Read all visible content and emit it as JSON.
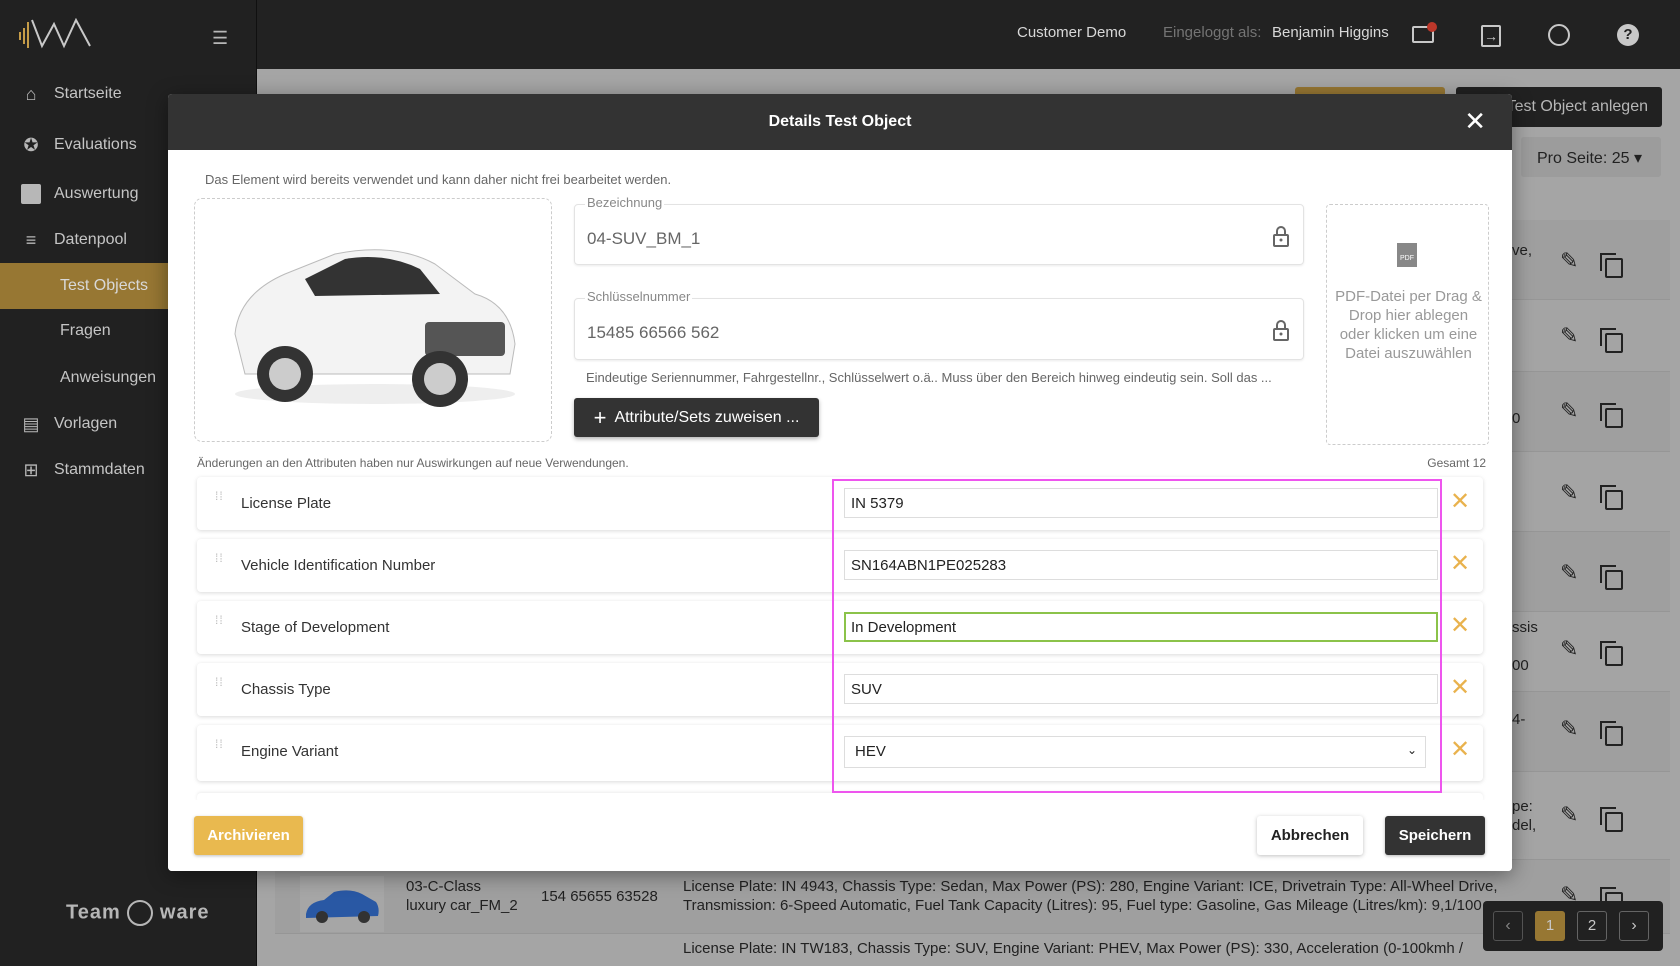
{
  "topbar": {
    "customer": "Customer Demo",
    "logged_in_label": "Eingeloggt als:",
    "user": "Benjamin Higgins"
  },
  "sidebar": {
    "items": [
      {
        "label": "Startseite",
        "icon": "home-icon"
      },
      {
        "label": "Evaluations",
        "icon": "star-icon"
      },
      {
        "label": "Auswertung",
        "icon": "chart-icon"
      },
      {
        "label": "Datenpool",
        "icon": "server-icon"
      },
      {
        "label": "Test Objects",
        "sub": true,
        "active": true
      },
      {
        "label": "Fragen",
        "sub": true
      },
      {
        "label": "Anweisungen",
        "sub": true
      },
      {
        "label": "Vorlagen",
        "icon": "layout-icon"
      },
      {
        "label": "Stammdaten",
        "icon": "hierarchy-icon"
      }
    ],
    "footer_logo": "Teamware SOLUTIONS"
  },
  "background": {
    "create_button": "Test Object anlegen",
    "per_page": "Pro Seite: 25",
    "row_fragments": [
      "ve,",
      "",
      "0",
      "",
      "",
      "ssis",
      "4-",
      "pe:",
      "del,",
      "00",
      ":"
    ],
    "list_row": {
      "name_line1": "03-C-Class",
      "name_line2": "luxury car_FM_2",
      "key": "154 65655 63528",
      "desc_line1": "License Plate: IN 4943, Chassis Type: Sedan, Max Power (PS): 280, Engine Variant: ICE, Drivetrain Type: All-Wheel Drive,",
      "desc_line2": "Transmission: 6-Speed Automatic, Fuel Tank Capacity (Litres): 95, Fuel type: Gasoline, Gas Mileage (Litres/km): 9,1/100"
    },
    "list_row2": {
      "desc_line1": "License Plate: IN TW183, Chassis Type: SUV, Engine Variant: PHEV, Max Power (PS): 330, Acceleration (0-100kmh /"
    },
    "pagination": {
      "pages": [
        "1",
        "2"
      ],
      "current": "1"
    }
  },
  "modal": {
    "title": "Details Test Object",
    "notice": "Das Element wird bereits verwendet und kann daher nicht frei bearbeitet werden.",
    "bezeichnung": {
      "label": "Bezeichnung",
      "value": "04-SUV_BM_1"
    },
    "schluessel": {
      "label": "Schlüsselnummer",
      "value": "15485 66566 562"
    },
    "hint": "Eindeutige Seriennummer, Fahrgestellnr., Schlüsselwert o.ä.. Muss über den Bereich hinweg eindeutig sein. Soll das ...",
    "assign_button": "Attribute/Sets zuweisen ...",
    "pdf_drop": "PDF-Datei per Drag & Drop hier ablegen oder klicken um eine Datei auszuwählen",
    "changes_note": "Änderungen an den Attributen haben nur Auswirkungen auf neue Verwendungen.",
    "total": "Gesamt 12",
    "attributes": [
      {
        "name": "License Plate",
        "value": "IN 5379",
        "type": "text"
      },
      {
        "name": "Vehicle Identification Number",
        "value": "SN164ABN1PE025283",
        "type": "text"
      },
      {
        "name": "Stage of Development",
        "value": "In Development",
        "type": "text",
        "focused": true
      },
      {
        "name": "Chassis Type",
        "value": "SUV",
        "type": "text"
      },
      {
        "name": "Engine Variant",
        "value": "HEV",
        "type": "select"
      }
    ],
    "archive_button": "Archivieren",
    "cancel_button": "Abbrechen",
    "save_button": "Speichern"
  },
  "colors": {
    "accent": "#e9b94f",
    "active_nav": "#9b7a35",
    "highlight": "#ee55ee",
    "focus": "#8bc34a"
  }
}
